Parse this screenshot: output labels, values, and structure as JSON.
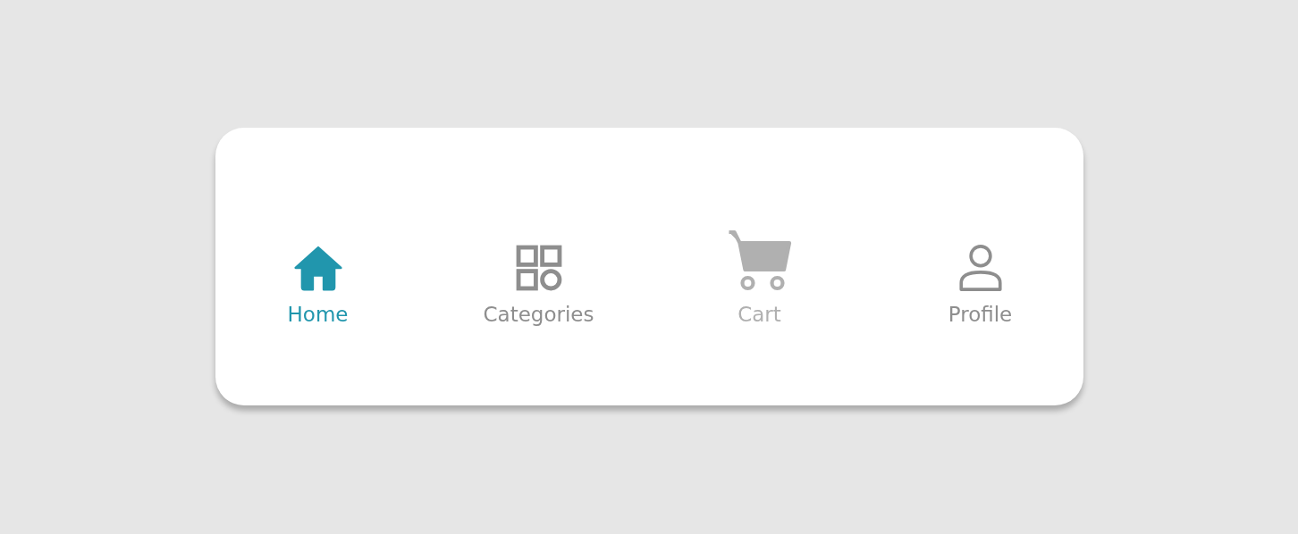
{
  "tabs": [
    {
      "kind": "home",
      "label": "Home",
      "selected": true,
      "disabled": false
    },
    {
      "kind": "categories",
      "label": "Categories",
      "selected": false,
      "disabled": false
    },
    {
      "kind": "cart",
      "label": "Cart",
      "selected": false,
      "disabled": true
    },
    {
      "kind": "profile",
      "label": "Profile",
      "selected": false,
      "disabled": false
    }
  ]
}
